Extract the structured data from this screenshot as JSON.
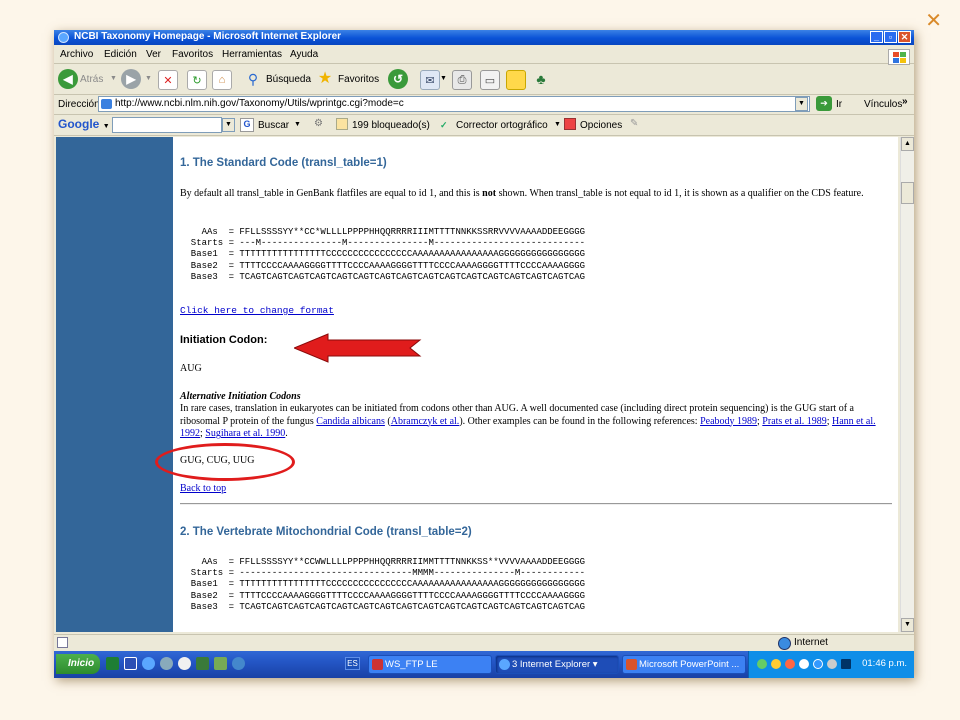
{
  "window": {
    "title": "NCBI Taxonomy Homepage - Microsoft Internet Explorer"
  },
  "menu": [
    "Archivo",
    "Edición",
    "Ver",
    "Favoritos",
    "Herramientas",
    "Ayuda"
  ],
  "toolbar": {
    "back": "Atrás",
    "search": "Búsqueda",
    "favorites": "Favoritos"
  },
  "address": {
    "label": "Dirección",
    "url": "http://www.ncbi.nlm.nih.gov/Taxonomy/Utils/wprintgc.cgi?mode=c",
    "go": "Ir",
    "links": "Vínculos"
  },
  "google": {
    "logo": "Google",
    "search": "Buscar",
    "blocked": "199 bloqueado(s)",
    "spell": "Corrector ortográfico",
    "options": "Opciones"
  },
  "page": {
    "section1": {
      "title": "1. The Standard Code (transl_table=1)",
      "intro_1": "By default all transl_table in GenBank flatfiles are equal to id 1, and this is ",
      "intro_bold": "not",
      "intro_2": " shown. When transl_table is not equal to id 1, it is shown as a qualifier on the CDS feature.",
      "code_table": "    AAs  = FFLLSSSSYY**CC*WLLLLPPPPHHQQRRRRIIIMTTTTNNKKSSRRVVVVAAAADDEEGGGG\n  Starts = ---M---------------M---------------M----------------------------\n  Base1  = TTTTTTTTTTTTTTTTCCCCCCCCCCCCCCCCAAAAAAAAAAAAAAAAGGGGGGGGGGGGGGGG\n  Base2  = TTTTCCCCAAAAGGGGTTTTCCCCAAAAGGGGTTTTCCCCAAAAGGGGTTTTCCCCAAAAGGGG\n  Base3  = TCAGTCAGTCAGTCAGTCAGTCAGTCAGTCAGTCAGTCAGTCAGTCAGTCAGTCAGTCAGTCAG",
      "change_format": "Click here to change format",
      "initiation_title": "Initiation Codon:",
      "initiation_codon": "AUG",
      "alt_title": "Alternative Initiation Codons",
      "alt_text_1": "In rare cases, translation in eukaryotes can be initiated from codons other than AUG. A well documented case (including direct protein sequencing) is the GUG start of a ribosomal P protein of the fungus ",
      "alt_link_candida": "Candida albicans",
      "alt_text_2": " (",
      "alt_link_abramczyk": "Abramczyk et al.",
      "alt_text_3": "). Other examples can be found in the following references: ",
      "alt_link_peabody": "Peabody 1989",
      "alt_sep1": "; ",
      "alt_link_prats": "Prats et al. 1989",
      "alt_sep2": "; ",
      "alt_link_hann": "Hann et al. 1992",
      "alt_sep3": "; ",
      "alt_link_sugihara": "Sugihara et al. 1990",
      "alt_end": ".",
      "alt_codons": "GUG, CUG, UUG",
      "back_to_top": "Back to top"
    },
    "section2": {
      "title": "2. The Vertebrate Mitochondrial Code (transl_table=2)",
      "code_table": "    AAs  = FFLLSSSSYY**CCWWLLLLPPPPHHQQRRRRIIMMTTTTNNKKSS**VVVVAAAADDEEGGGG\n  Starts = --------------------------------MMMM---------------M------------\n  Base1  = TTTTTTTTTTTTTTTTCCCCCCCCCCCCCCCCAAAAAAAAAAAAAAAAGGGGGGGGGGGGGGGG\n  Base2  = TTTTCCCCAAAAGGGGTTTTCCCCAAAAGGGGTTTTCCCCAAAAGGGGTTTTCCCCAAAAGGGG\n  Base3  = TCAGTCAGTCAGTCAGTCAGTCAGTCAGTCAGTCAGTCAGTCAGTCAGTCAGTCAGTCAGTCAG"
    }
  },
  "status": {
    "zone": "Internet"
  },
  "taskbar": {
    "start": "Inicio",
    "lang": "ES",
    "tasks": [
      "WS_FTP LE",
      "3 Internet Explorer",
      "Microsoft PowerPoint ..."
    ],
    "clock": "01:46 p.m."
  },
  "colors": {
    "annotation": "#e01c1c",
    "ncbi_sidebar": "#336699",
    "heading": "#336699",
    "link": "#0000cc"
  }
}
